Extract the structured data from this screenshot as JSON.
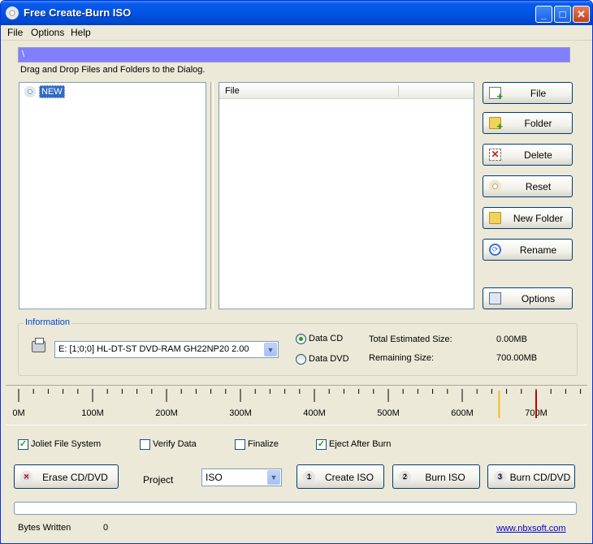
{
  "titlebar": {
    "title": "Free Create-Burn ISO",
    "minimize": "_",
    "maximize": "□",
    "close": "✕"
  },
  "menu": {
    "items": [
      "File",
      "Options",
      "Help"
    ]
  },
  "path": "\\",
  "hint": "Drag and Drop Files and Folders to the Dialog.",
  "tree": {
    "root_label": "NEW"
  },
  "list": {
    "columns": [
      "File",
      ""
    ]
  },
  "side_buttons": [
    "File",
    "Folder",
    "Delete",
    "Reset",
    "New Folder",
    "Rename",
    "Options"
  ],
  "information": {
    "legend": "Information",
    "drive": "E: [1;0;0] HL-DT-ST DVD-RAM GH22NP20 2.00",
    "radio_data_cd": "Data CD",
    "radio_data_dvd": "Data DVD",
    "selected_media": "Data CD",
    "total_label": "Total Estimated Size:",
    "total_value": "0.00MB",
    "remaining_label": "Remaining Size:",
    "remaining_value": "700.00MB"
  },
  "ruler": {
    "tick_labels": [
      "0M",
      "100M",
      "200M",
      "300M",
      "400M",
      "500M",
      "600M",
      "700M"
    ],
    "max_mb": 760,
    "minor_step_mb": 20,
    "marker_yellow_mb": 650,
    "marker_red_mb": 700,
    "marker_yellow_color": "#e8c020",
    "marker_red_color": "#c00000"
  },
  "options": {
    "joliet": {
      "label": "Joliet File System",
      "checked": true
    },
    "verify": {
      "label": "Verify Data",
      "checked": false
    },
    "finalize": {
      "label": "Finalize",
      "checked": false
    },
    "eject": {
      "label": "Eject After Burn",
      "checked": true
    }
  },
  "actions": {
    "erase": "Erase CD/DVD",
    "project_label": "Project",
    "project_value": "ISO",
    "create_iso": "Create ISO",
    "create_iso_num": "1",
    "burn_iso": "Burn ISO",
    "burn_iso_num": "2",
    "burn_cd": "Burn CD/DVD",
    "burn_cd_num": "3"
  },
  "progress": 0,
  "status": {
    "bytes_label": "Bytes Written",
    "bytes_value": "0",
    "link": "www.nbxsoft.com"
  }
}
